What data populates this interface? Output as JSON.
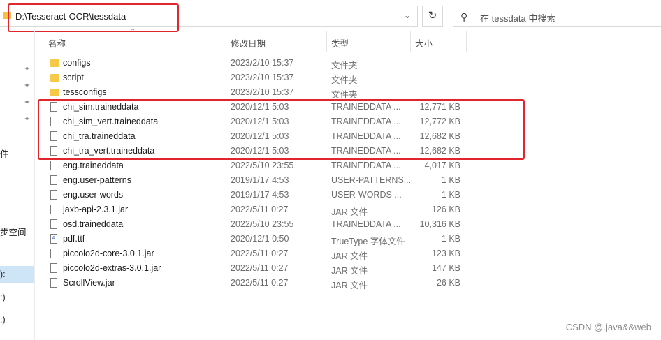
{
  "address": {
    "path": "D:\\Tesseract-OCR\\tessdata"
  },
  "search": {
    "placeholder": "在 tessdata 中搜索"
  },
  "columns": {
    "name": "名称",
    "date": "修改日期",
    "type": "类型",
    "size": "大小"
  },
  "nav": {
    "item1": "件",
    "item2": "步空间",
    "item3": "):",
    "item4": ":)",
    "item5": ":)"
  },
  "files": [
    {
      "name": "configs",
      "date": "2023/2/10 15:37",
      "type": "文件夹",
      "size": "",
      "icon": "folder-icon"
    },
    {
      "name": "script",
      "date": "2023/2/10 15:37",
      "type": "文件夹",
      "size": "",
      "icon": "folder-icon"
    },
    {
      "name": "tessconfigs",
      "date": "2023/2/10 15:37",
      "type": "文件夹",
      "size": "",
      "icon": "folder-icon"
    },
    {
      "name": "chi_sim.traineddata",
      "date": "2020/12/1 5:03",
      "type": "TRAINEDDATA ...",
      "size": "12,771 KB",
      "icon": "file-icon"
    },
    {
      "name": "chi_sim_vert.traineddata",
      "date": "2020/12/1 5:03",
      "type": "TRAINEDDATA ...",
      "size": "12,772 KB",
      "icon": "file-icon"
    },
    {
      "name": "chi_tra.traineddata",
      "date": "2020/12/1 5:03",
      "type": "TRAINEDDATA ...",
      "size": "12,682 KB",
      "icon": "file-icon"
    },
    {
      "name": "chi_tra_vert.traineddata",
      "date": "2020/12/1 5:03",
      "type": "TRAINEDDATA ...",
      "size": "12,682 KB",
      "icon": "file-icon"
    },
    {
      "name": "eng.traineddata",
      "date": "2022/5/10 23:55",
      "type": "TRAINEDDATA ...",
      "size": "4,017 KB",
      "icon": "file-icon"
    },
    {
      "name": "eng.user-patterns",
      "date": "2019/1/17 4:53",
      "type": "USER-PATTERNS...",
      "size": "1 KB",
      "icon": "file-icon"
    },
    {
      "name": "eng.user-words",
      "date": "2019/1/17 4:53",
      "type": "USER-WORDS ...",
      "size": "1 KB",
      "icon": "file-icon"
    },
    {
      "name": "jaxb-api-2.3.1.jar",
      "date": "2022/5/11 0:27",
      "type": "JAR 文件",
      "size": "126 KB",
      "icon": "file-icon"
    },
    {
      "name": "osd.traineddata",
      "date": "2022/5/10 23:55",
      "type": "TRAINEDDATA ...",
      "size": "10,316 KB",
      "icon": "file-icon"
    },
    {
      "name": "pdf.ttf",
      "date": "2020/12/1 0:50",
      "type": "TrueType 字体文件",
      "size": "1 KB",
      "icon": "font-file-icon"
    },
    {
      "name": "piccolo2d-core-3.0.1.jar",
      "date": "2022/5/11 0:27",
      "type": "JAR 文件",
      "size": "123 KB",
      "icon": "file-icon"
    },
    {
      "name": "piccolo2d-extras-3.0.1.jar",
      "date": "2022/5/11 0:27",
      "type": "JAR 文件",
      "size": "147 KB",
      "icon": "file-icon"
    },
    {
      "name": "ScrollView.jar",
      "date": "2022/5/11 0:27",
      "type": "JAR 文件",
      "size": "26 KB",
      "icon": "file-icon"
    }
  ],
  "watermark": "CSDN @.java&&web",
  "colors": {
    "highlight": "#e0262b",
    "selection": "#cde5f7",
    "folder": "#f7c948"
  }
}
